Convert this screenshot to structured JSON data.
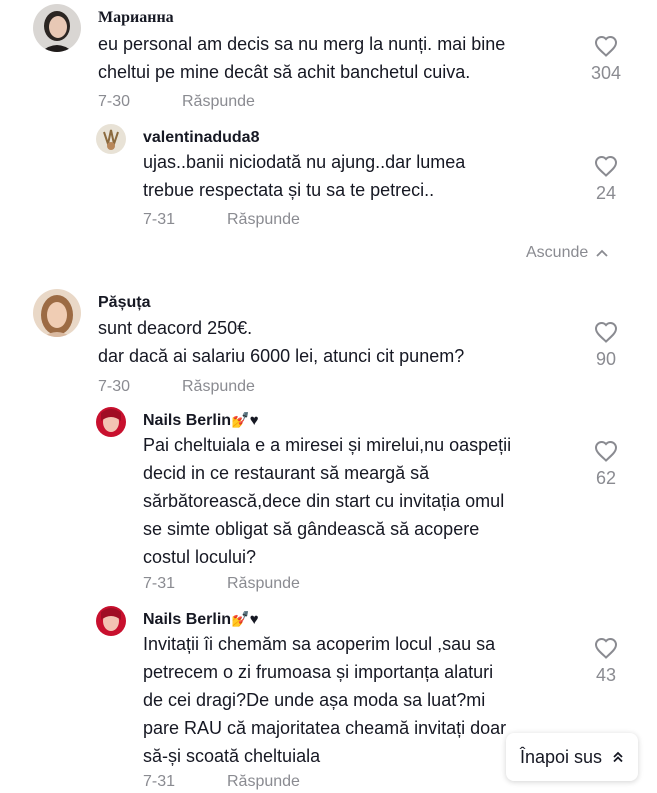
{
  "colors": {
    "text": "#161823",
    "muted": "#8a8b91",
    "background": "#ffffff"
  },
  "comments": [
    {
      "user": "Марианна",
      "lines": [
        "eu personal am decis sa nu merg la nunți. mai bine",
        "cheltui pe mine decât să achit banchetul cuiva."
      ],
      "date": "7-30",
      "reply_label": "Răspunde",
      "likes": "304",
      "replies": [
        {
          "user": "valentinaduda8",
          "lines": [
            "ujas..banii niciodată nu ajung..dar lumea",
            "trebue respectata și tu sa te petreci.."
          ],
          "date": "7-31",
          "reply_label": "Răspunde",
          "likes": "24"
        }
      ],
      "hide_label": "Ascunde",
      "hide_icon": "chevron-up-icon"
    },
    {
      "user": "Pășuța",
      "lines": [
        "sunt deacord 250€.",
        "dar dacă ai salariu 6000 lei, atunci cit punem?"
      ],
      "date": "7-30",
      "reply_label": "Răspunde",
      "likes": "90",
      "replies": [
        {
          "user": "Nails Berlin",
          "user_suffix": "💅♥",
          "lines": [
            "Pai cheltuiala e a miresei și mirelui,nu oaspeții",
            "decid in ce restaurant să meargă să",
            "sărbătorească,dece din start cu invitația omul",
            "se simte obligat să gândească să acopere",
            "costul locului?"
          ],
          "date": "7-31",
          "reply_label": "Răspunde",
          "likes": "62"
        },
        {
          "user": "Nails Berlin",
          "user_suffix": "💅♥",
          "lines": [
            "Invitații îi chemăm sa acoperim locul ,sau sa",
            "petrecem o zi frumoasa și importanța alaturi",
            "de cei dragi?De unde așa moda sa luat?mi",
            "pare RAU că majoritatea cheamă invitați doar",
            "să-și scoată cheltuiala"
          ],
          "date": "7-31",
          "reply_label": "Răspunde",
          "likes": "43"
        }
      ]
    }
  ],
  "back_to_top": {
    "label": "Înapoi sus",
    "icon": "double-chevron-up-icon"
  }
}
